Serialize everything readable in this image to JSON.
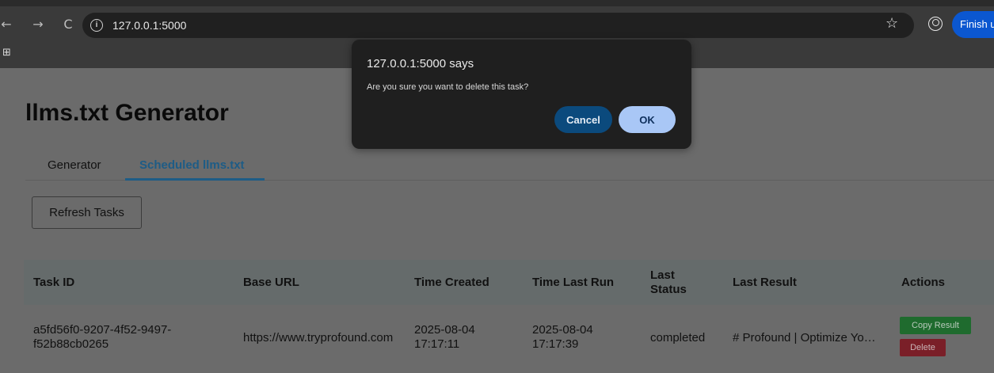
{
  "browser": {
    "back_icon": "←",
    "forward_icon": "→",
    "reload_icon": "C",
    "url": "127.0.0.1:5000",
    "star_icon": "☆",
    "finish_label": "Finish u",
    "apps_icon": "⊞"
  },
  "page": {
    "title": "llms.txt Generator",
    "tabs": [
      {
        "label": "Generator"
      },
      {
        "label": "Scheduled llms.txt"
      }
    ],
    "refresh_label": "Refresh Tasks"
  },
  "table": {
    "headers": [
      "Task ID",
      "Base URL",
      "Time Created",
      "Time Last Run",
      "Last Status",
      "Last Result",
      "Actions"
    ],
    "headers_split": {
      "last_status_1": "Last",
      "last_status_2": "Status"
    },
    "rows": [
      {
        "task_id_1": "a5fd56f0-9207-4f52-9497-",
        "task_id_2": "f52b88cb0265",
        "base_url": "https://www.tryprofound.com",
        "created_date": "2025-08-04",
        "created_time": "17:17:11",
        "last_run_date": "2025-08-04",
        "last_run_time": "17:17:39",
        "status": "completed",
        "result": "# Profound | Optimize Yo…",
        "copy_label": "Copy Result",
        "delete_label": "Delete"
      }
    ]
  },
  "dialog": {
    "title": "127.0.0.1:5000 says",
    "message": "Are you sure you want to delete this task?",
    "cancel_label": "Cancel",
    "ok_label": "OK"
  },
  "colors": {
    "dialog_bg": "#1f1f1f",
    "cancel_bg": "#0b4a7d",
    "ok_bg": "#a9c7f6",
    "tab_active": "#1e5c86",
    "copy_btn": "#1f6b2e",
    "delete_btn": "#7a1f28"
  }
}
